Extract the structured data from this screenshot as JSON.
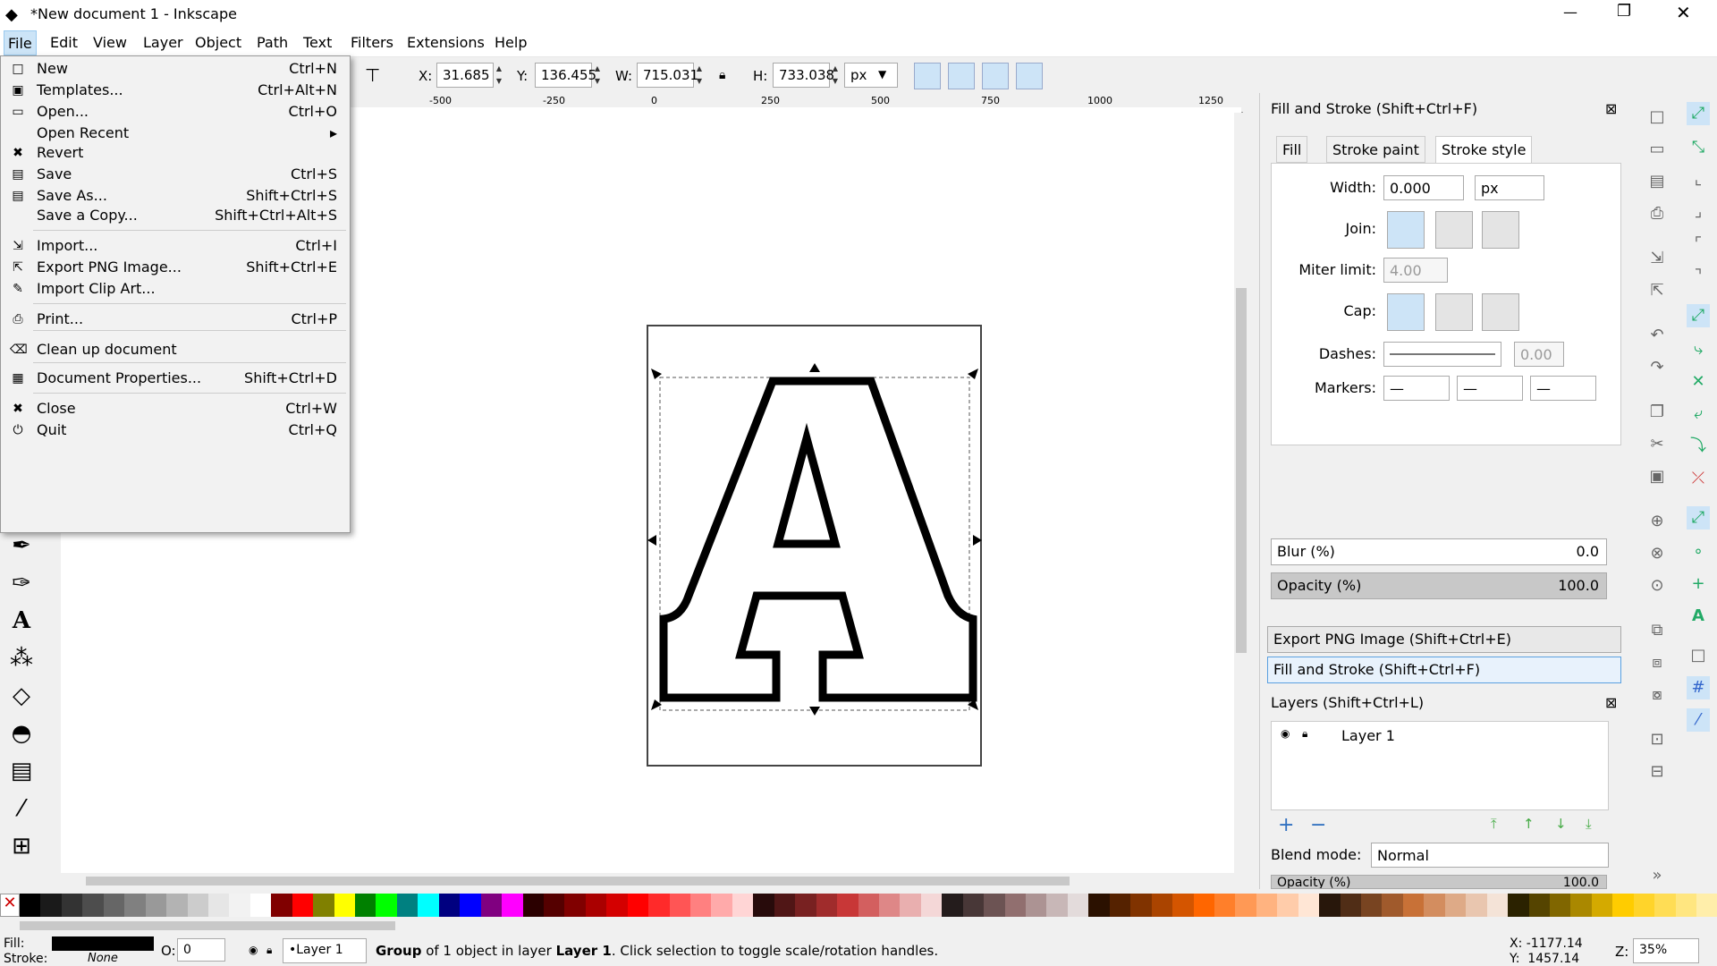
{
  "window": {
    "title": "*New document 1 - Inkscape",
    "minimize": "—",
    "restore": "❐",
    "close": "✕"
  },
  "menubar": [
    "File",
    "Edit",
    "View",
    "Layer",
    "Object",
    "Path",
    "Text",
    "Filters",
    "Extensions",
    "Help"
  ],
  "toolbar": {
    "x_label": "X:",
    "x": "31.685",
    "y_label": "Y:",
    "y": "136.455",
    "w_label": "W:",
    "w": "715.031",
    "h_label": "H:",
    "h": "733.038",
    "unit": "px"
  },
  "ruler_labels": [
    "-500",
    "-250",
    "0",
    "250",
    "500",
    "750",
    "1000",
    "1250"
  ],
  "file_menu": [
    {
      "label": "New",
      "accel": "Ctrl+N",
      "icon": "new-doc-icon",
      "glyph": "□"
    },
    {
      "label": "Templates...",
      "accel": "Ctrl+Alt+N",
      "icon": "templates-icon",
      "glyph": "▣"
    },
    {
      "label": "Open...",
      "accel": "Ctrl+O",
      "icon": "open-folder-icon",
      "glyph": "▭"
    },
    {
      "label": "Open Recent",
      "accel": "",
      "icon": "",
      "glyph": "",
      "submenu": "▸"
    },
    {
      "label": "Revert",
      "accel": "",
      "icon": "revert-icon",
      "glyph": "✖"
    },
    {
      "label": "Save",
      "accel": "Ctrl+S",
      "icon": "save-icon",
      "glyph": "▤"
    },
    {
      "label": "Save As...",
      "accel": "Shift+Ctrl+S",
      "icon": "save-as-icon",
      "glyph": "▤"
    },
    {
      "label": "Save a Copy...",
      "accel": "Shift+Ctrl+Alt+S",
      "icon": "",
      "glyph": ""
    },
    {
      "label": "Import...",
      "accel": "Ctrl+I",
      "icon": "import-icon",
      "glyph": "⇲"
    },
    {
      "label": "Export PNG Image...",
      "accel": "Shift+Ctrl+E",
      "icon": "export-icon",
      "glyph": "⇱"
    },
    {
      "label": "Import Clip Art...",
      "accel": "",
      "icon": "clipart-icon",
      "glyph": "✎"
    },
    {
      "label": "Print...",
      "accel": "Ctrl+P",
      "icon": "print-icon",
      "glyph": "⎙"
    },
    {
      "label": "Clean up document",
      "accel": "",
      "icon": "cleanup-icon",
      "glyph": "⌫"
    },
    {
      "label": "Document Properties...",
      "accel": "Shift+Ctrl+D",
      "icon": "doc-props-icon",
      "glyph": "▦"
    },
    {
      "label": "Close",
      "accel": "Ctrl+W",
      "icon": "close-doc-icon",
      "glyph": "✖"
    },
    {
      "label": "Quit",
      "accel": "Ctrl+Q",
      "icon": "quit-icon",
      "glyph": "⏻"
    }
  ],
  "fill_stroke": {
    "title": "Fill and Stroke (Shift+Ctrl+F)",
    "tabs": [
      "Fill",
      "Stroke paint",
      "Stroke style"
    ],
    "width_label": "Width:",
    "width": "0.000",
    "width_unit": "px",
    "join_label": "Join:",
    "miter_label": "Miter limit:",
    "miter": "4.00",
    "cap_label": "Cap:",
    "dashes_label": "Dashes:",
    "dash_offset": "0.00",
    "markers_label": "Markers:",
    "marker_value": "—",
    "blur_label": "Blur (%)",
    "blur": "0.0",
    "opacity_label": "Opacity (%)",
    "opacity": "100.0"
  },
  "dock_collapsed": {
    "export": "Export PNG Image (Shift+Ctrl+E)",
    "fill": "Fill and Stroke (Shift+Ctrl+F)"
  },
  "layers": {
    "title": "Layers (Shift+Ctrl+L)",
    "layer": "Layer 1",
    "blend_label": "Blend mode:",
    "blend": "Normal",
    "opacity_label": "Opacity (%)",
    "opacity": "100.0"
  },
  "status": {
    "fill_label": "Fill:",
    "stroke_label": "Stroke:",
    "stroke_value": "None",
    "o_label": "O:",
    "o_value": "0",
    "layer": "•Layer 1",
    "msg_pre": "Group",
    "msg_mid1": " of 1 object in layer ",
    "msg_layer": "Layer 1",
    "msg_post": ". Click selection to toggle scale/rotation handles.",
    "x_coord": "X: -1177.14",
    "y_coord": "Y:  1457.14",
    "zoom_label": "Z:",
    "zoom": "35%"
  },
  "palette": [
    "#000000",
    "#1a1a1a",
    "#333333",
    "#4d4d4d",
    "#666666",
    "#808080",
    "#999999",
    "#b3b3b3",
    "#cccccc",
    "#e6e6e6",
    "#f2f2f2",
    "#ffffff",
    "#800000",
    "#ff0000",
    "#808000",
    "#ffff00",
    "#008000",
    "#00ff00",
    "#008080",
    "#00ffff",
    "#000080",
    "#0000ff",
    "#800080",
    "#ff00ff",
    "#2b0000",
    "#550000",
    "#800000",
    "#aa0000",
    "#d40000",
    "#ff0000",
    "#ff2a2a",
    "#ff5555",
    "#ff8080",
    "#ffaaaa",
    "#ffd5d5",
    "#280b0b",
    "#501616",
    "#782121",
    "#a02c2c",
    "#c83737",
    "#d35f5f",
    "#de8787",
    "#e9afaf",
    "#f4d7d7",
    "#241c1c",
    "#483737",
    "#6c5353",
    "#916f6f",
    "#ac9393",
    "#c8b7b7",
    "#e3dbdb",
    "#2b1100",
    "#552200",
    "#803300",
    "#aa4400",
    "#d45500",
    "#ff6600",
    "#ff7f2a",
    "#ff9955",
    "#ffb380",
    "#ffccaa",
    "#ffe6d5",
    "#28170b",
    "#502d16",
    "#784421",
    "#a05a2c",
    "#c87137",
    "#d38d5f",
    "#deaa87",
    "#e9c6af",
    "#f4e3d7",
    "#2b2200",
    "#554400",
    "#806600",
    "#aa8800",
    "#d4aa00",
    "#ffcc00",
    "#ffd42a",
    "#ffdd55",
    "#ffe680",
    "#ffeeaa"
  ]
}
